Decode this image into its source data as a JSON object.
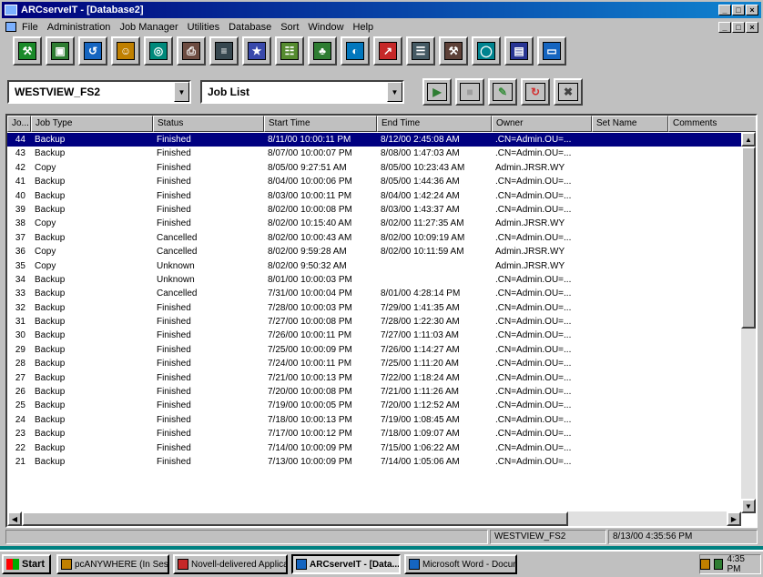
{
  "window": {
    "title": "ARCserveIT - [Database2]",
    "caption_buttons": [
      "_",
      "□",
      "×"
    ],
    "mdi_buttons": [
      "_",
      "□",
      "×"
    ]
  },
  "menu": [
    "File",
    "Administration",
    "Job Manager",
    "Utilities",
    "Database",
    "Sort",
    "Window",
    "Help"
  ],
  "toolbar_icons": [
    {
      "name": "manager-icon",
      "color": "#1a8a2a",
      "glyph": "⚒"
    },
    {
      "name": "backup-icon",
      "color": "#2e7d32",
      "glyph": "▣"
    },
    {
      "name": "restore-icon",
      "color": "#1565c0",
      "glyph": "↺"
    },
    {
      "name": "users-icon",
      "color": "#c08000",
      "glyph": "☺"
    },
    {
      "name": "tape-icon",
      "color": "#00897b",
      "glyph": "◎"
    },
    {
      "name": "printer-icon",
      "color": "#6d4c41",
      "glyph": "⎙"
    },
    {
      "name": "database-icon",
      "color": "#37474f",
      "glyph": "≡"
    },
    {
      "name": "wizard-icon",
      "color": "#3949ab",
      "glyph": "★"
    },
    {
      "name": "network-icon",
      "color": "#558b2f",
      "glyph": "☷"
    },
    {
      "name": "tree-icon",
      "color": "#2e7d32",
      "glyph": "♣"
    },
    {
      "name": "globe-icon",
      "color": "#0277bd",
      "glyph": "◐"
    },
    {
      "name": "chart-icon",
      "color": "#c62828",
      "glyph": "↗"
    },
    {
      "name": "server-icon",
      "color": "#455a64",
      "glyph": "☰"
    },
    {
      "name": "tools-icon",
      "color": "#5d4037",
      "glyph": "⚒"
    },
    {
      "name": "scan-icon",
      "color": "#00838f",
      "glyph": "◯"
    },
    {
      "name": "report-icon",
      "color": "#283593",
      "glyph": "▤"
    },
    {
      "name": "window-icon",
      "color": "#1565c0",
      "glyph": "▭"
    }
  ],
  "server_combo": {
    "value": "WESTVIEW_FS2"
  },
  "view_combo": {
    "value": "Job List"
  },
  "toolbar2_icons": [
    {
      "name": "run-job-icon",
      "color": "#2e7d32",
      "glyph": "▶"
    },
    {
      "name": "stop-job-icon",
      "color": "#9e9e9e",
      "glyph": "■"
    },
    {
      "name": "modify-job-icon",
      "color": "#388e3c",
      "glyph": "✎"
    },
    {
      "name": "reschedule-icon",
      "color": "#d32f2f",
      "glyph": "↻"
    },
    {
      "name": "delete-job-icon",
      "color": "#424242",
      "glyph": "✖"
    }
  ],
  "columns": [
    "Jo...",
    "Job Type",
    "Status",
    "Start Time",
    "End Time",
    "Owner",
    "Set Name",
    "Comments"
  ],
  "rows": [
    [
      "44",
      "Backup",
      "Finished",
      "8/11/00 10:00:11 PM",
      "8/12/00 2:45:08 AM",
      ".CN=Admin.OU=...",
      "",
      ""
    ],
    [
      "43",
      "Backup",
      "Finished",
      "8/07/00 10:00:07 PM",
      "8/08/00 1:47:03 AM",
      ".CN=Admin.OU=...",
      "",
      ""
    ],
    [
      "42",
      "Copy",
      "Finished",
      "8/05/00 9:27:51 AM",
      "8/05/00 10:23:43 AM",
      "Admin.JRSR.WY",
      "",
      ""
    ],
    [
      "41",
      "Backup",
      "Finished",
      "8/04/00 10:00:06 PM",
      "8/05/00 1:44:36 AM",
      ".CN=Admin.OU=...",
      "",
      ""
    ],
    [
      "40",
      "Backup",
      "Finished",
      "8/03/00 10:00:11 PM",
      "8/04/00 1:42:24 AM",
      ".CN=Admin.OU=...",
      "",
      ""
    ],
    [
      "39",
      "Backup",
      "Finished",
      "8/02/00 10:00:08 PM",
      "8/03/00 1:43:37 AM",
      ".CN=Admin.OU=...",
      "",
      ""
    ],
    [
      "38",
      "Copy",
      "Finished",
      "8/02/00 10:15:40 AM",
      "8/02/00 11:27:35 AM",
      "Admin.JRSR.WY",
      "",
      ""
    ],
    [
      "37",
      "Backup",
      "Cancelled",
      "8/02/00 10:00:43 AM",
      "8/02/00 10:09:19 AM",
      ".CN=Admin.OU=...",
      "",
      ""
    ],
    [
      "36",
      "Copy",
      "Cancelled",
      "8/02/00 9:59:28 AM",
      "8/02/00 10:11:59 AM",
      "Admin.JRSR.WY",
      "",
      ""
    ],
    [
      "35",
      "Copy",
      "Unknown",
      "8/02/00 9:50:32 AM",
      "",
      "Admin.JRSR.WY",
      "",
      ""
    ],
    [
      "34",
      "Backup",
      "Unknown",
      "8/01/00 10:00:03 PM",
      "",
      ".CN=Admin.OU=...",
      "",
      ""
    ],
    [
      "33",
      "Backup",
      "Cancelled",
      "7/31/00 10:00:04 PM",
      "8/01/00 4:28:14 PM",
      ".CN=Admin.OU=...",
      "",
      ""
    ],
    [
      "32",
      "Backup",
      "Finished",
      "7/28/00 10:00:03 PM",
      "7/29/00 1:41:35 AM",
      ".CN=Admin.OU=...",
      "",
      ""
    ],
    [
      "31",
      "Backup",
      "Finished",
      "7/27/00 10:00:08 PM",
      "7/28/00 1:22:30 AM",
      ".CN=Admin.OU=...",
      "",
      ""
    ],
    [
      "30",
      "Backup",
      "Finished",
      "7/26/00 10:00:11 PM",
      "7/27/00 1:11:03 AM",
      ".CN=Admin.OU=...",
      "",
      ""
    ],
    [
      "29",
      "Backup",
      "Finished",
      "7/25/00 10:00:09 PM",
      "7/26/00 1:14:27 AM",
      ".CN=Admin.OU=...",
      "",
      ""
    ],
    [
      "28",
      "Backup",
      "Finished",
      "7/24/00 10:00:11 PM",
      "7/25/00 1:11:20 AM",
      ".CN=Admin.OU=...",
      "",
      ""
    ],
    [
      "27",
      "Backup",
      "Finished",
      "7/21/00 10:00:13 PM",
      "7/22/00 1:18:24 AM",
      ".CN=Admin.OU=...",
      "",
      ""
    ],
    [
      "26",
      "Backup",
      "Finished",
      "7/20/00 10:00:08 PM",
      "7/21/00 1:11:26 AM",
      ".CN=Admin.OU=...",
      "",
      ""
    ],
    [
      "25",
      "Backup",
      "Finished",
      "7/19/00 10:00:05 PM",
      "7/20/00 1:12:52 AM",
      ".CN=Admin.OU=...",
      "",
      ""
    ],
    [
      "24",
      "Backup",
      "Finished",
      "7/18/00 10:00:13 PM",
      "7/19/00 1:08:45 AM",
      ".CN=Admin.OU=...",
      "",
      ""
    ],
    [
      "23",
      "Backup",
      "Finished",
      "7/17/00 10:00:12 PM",
      "7/18/00 1:09:07 AM",
      ".CN=Admin.OU=...",
      "",
      ""
    ],
    [
      "22",
      "Backup",
      "Finished",
      "7/14/00 10:00:09 PM",
      "7/15/00 1:06:22 AM",
      ".CN=Admin.OU=...",
      "",
      ""
    ],
    [
      "21",
      "Backup",
      "Finished",
      "7/13/00 10:00:09 PM",
      "7/14/00 1:05:06 AM",
      ".CN=Admin.OU=...",
      "",
      ""
    ]
  ],
  "selected_row": 0,
  "status": {
    "server": "WESTVIEW_FS2",
    "datetime": "8/13/00  4:35:56 PM"
  },
  "taskbar": {
    "start_label": "Start",
    "tasks": [
      {
        "label": "pcANYWHERE (In Sessi...",
        "active": false,
        "icon_color": "#c08000"
      },
      {
        "label": "Novell-delivered Applicati...",
        "active": false,
        "icon_color": "#c62828"
      },
      {
        "label": "ARCserveIT - [Data...",
        "active": true,
        "icon_color": "#1565c0"
      },
      {
        "label": "Microsoft Word - Docum...",
        "active": false,
        "icon_color": "#1565c0"
      }
    ],
    "clock": "4:35 PM"
  }
}
